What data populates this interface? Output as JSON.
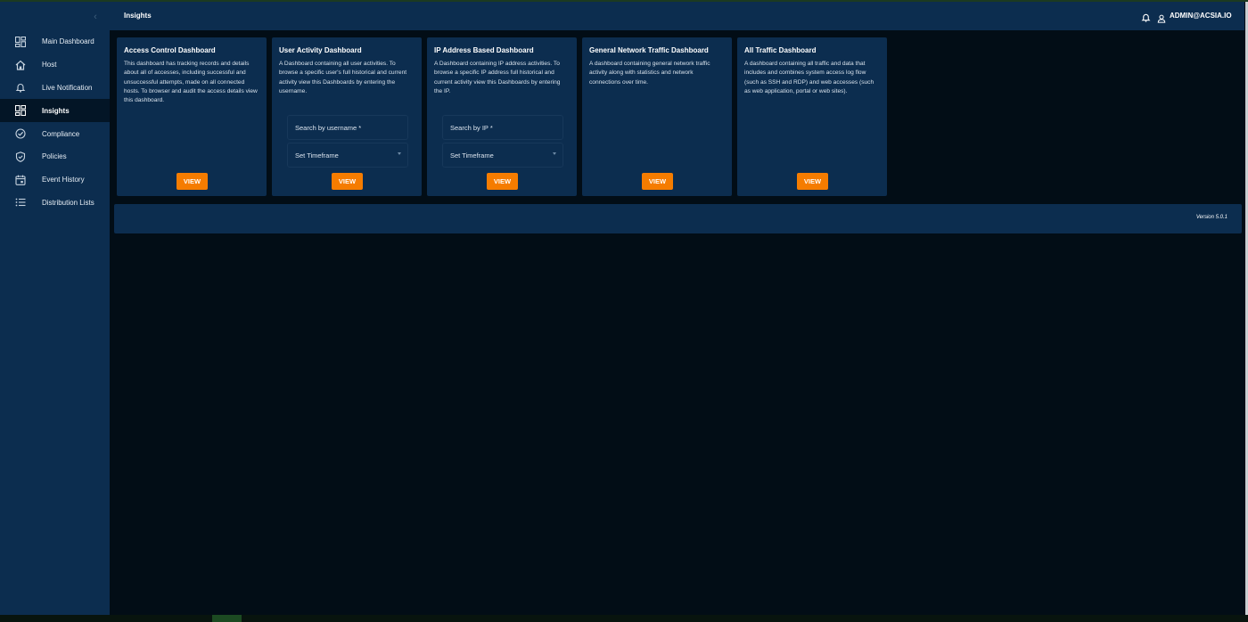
{
  "app": {
    "page_title": "Insights",
    "user": "ADMIN@ACSIA.IO",
    "version": "Version 5.0.1"
  },
  "sidebar": {
    "collapse_icon": "chevron-left-icon",
    "items": [
      {
        "label": "Main Dashboard",
        "icon": "dashboard-icon",
        "active": false
      },
      {
        "label": "Host",
        "icon": "home-icon",
        "active": false
      },
      {
        "label": "Live Notification",
        "icon": "bell-icon",
        "active": false
      },
      {
        "label": "Insights",
        "icon": "dashboard-icon",
        "active": true
      },
      {
        "label": "Compliance",
        "icon": "compliance-icon",
        "active": false
      },
      {
        "label": "Policies",
        "icon": "shield-icon",
        "active": false
      },
      {
        "label": "Event History",
        "icon": "calendar-icon",
        "active": false
      },
      {
        "label": "Distribution Lists",
        "icon": "list-icon",
        "active": false
      }
    ]
  },
  "cards": [
    {
      "title": "Access Control Dashboard",
      "description": "This dashboard has tracking records and details about all of accesses, including successful and unsuccessful attempts, made on all connected hosts. To browser and audit the access details view this dashboard.",
      "button": "VIEW"
    },
    {
      "title": "User Activity Dashboard",
      "description": "A Dashboard containing all user activities. To browse a specific user's full historical and current activity view this Dashboards by entering the username.",
      "search_placeholder": "Search by username *",
      "timeframe_label": "Set Timeframe",
      "button": "VIEW"
    },
    {
      "title": "IP Address Based Dashboard",
      "description": "A Dashboard containing IP address activities. To browse a specific IP address full historical and current activity view this Dashboards by entering the IP.",
      "search_placeholder": "Search by IP *",
      "timeframe_label": "Set Timeframe",
      "button": "VIEW"
    },
    {
      "title": "General Network Traffic Dashboard",
      "description": "A dashboard containing general network traffic activity along with statistics and network connections over time.",
      "button": "VIEW"
    },
    {
      "title": "All Traffic Dashboard",
      "description": "A dashboard containing all traffic and data that includes and combines system access log flow (such as SSH and RDP) and web accesses (such as web application, portal or web sites).",
      "button": "VIEW"
    }
  ],
  "colors": {
    "panel": "#0c2d4f",
    "background": "#020d16",
    "accent": "#f57c00"
  }
}
